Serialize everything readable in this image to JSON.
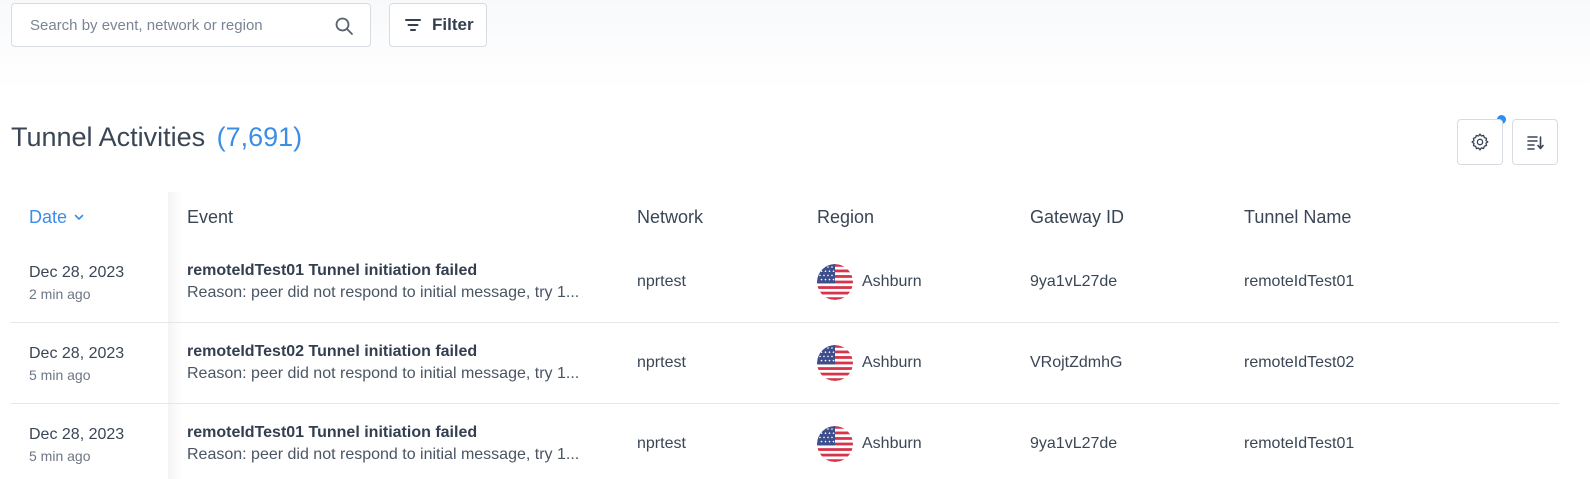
{
  "toolbar": {
    "search_placeholder": "Search by event, network or region",
    "search_value": "",
    "filter_label": "Filter"
  },
  "header": {
    "title": "Tunnel Activities",
    "count": "(7,691)",
    "settings_has_notification": true
  },
  "table": {
    "columns": {
      "date": "Date",
      "event": "Event",
      "network": "Network",
      "region": "Region",
      "gateway": "Gateway ID",
      "tunnel": "Tunnel Name"
    },
    "sort": {
      "column": "date",
      "direction": "desc"
    },
    "rows": [
      {
        "date": "Dec 28, 2023",
        "ago": "2 min ago",
        "event_title": "remoteIdTest01 Tunnel initiation failed",
        "event_reason": "Reason: peer did not respond to initial message, try 1...",
        "network": "nprtest",
        "region": "Ashburn",
        "region_flag": "us-flag-icon",
        "gateway": "9ya1vL27de",
        "tunnel": "remoteIdTest01"
      },
      {
        "date": "Dec 28, 2023",
        "ago": "5 min ago",
        "event_title": "remoteIdTest02 Tunnel initiation failed",
        "event_reason": "Reason: peer did not respond to initial message, try 1...",
        "network": "nprtest",
        "region": "Ashburn",
        "region_flag": "us-flag-icon",
        "gateway": "VRojtZdmhG",
        "tunnel": "remoteIdTest02"
      },
      {
        "date": "Dec 28, 2023",
        "ago": "5 min ago",
        "event_title": "remoteIdTest01 Tunnel initiation failed",
        "event_reason": "Reason: peer did not respond to initial message, try 1...",
        "network": "nprtest",
        "region": "Ashburn",
        "region_flag": "us-flag-icon",
        "gateway": "9ya1vL27de",
        "tunnel": "remoteIdTest01"
      }
    ]
  },
  "colors": {
    "accent": "#3b8ee6",
    "notification_dot": "#2f8cf0",
    "text": "#3a4656",
    "border": "#d7dce3"
  }
}
